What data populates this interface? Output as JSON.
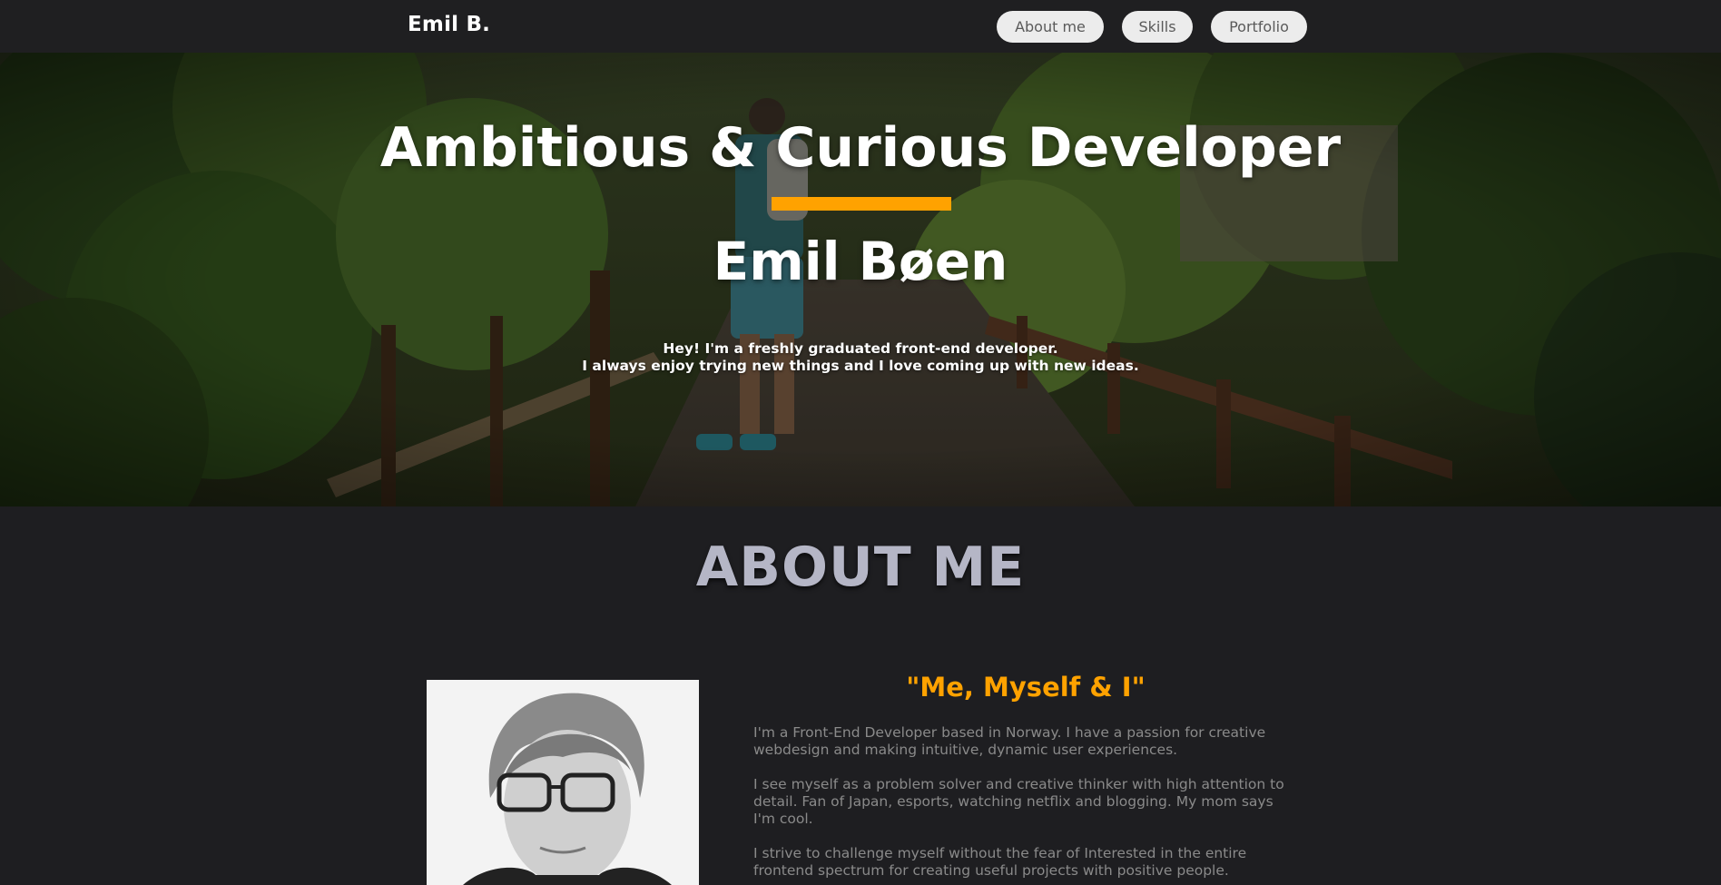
{
  "nav": {
    "brand": "Emil B.",
    "items": [
      {
        "label": "About me"
      },
      {
        "label": "Skills"
      },
      {
        "label": "Portfolio"
      }
    ]
  },
  "hero": {
    "title": "Ambitious & Curious Developer",
    "name": "Emil Bøen",
    "intro_line1": "Hey! I'm a freshly graduated front-end developer.",
    "intro_line2": "I always enjoy trying new things and I love coming up with new ideas."
  },
  "about": {
    "heading": "ABOUT ME",
    "subtitle": "\"Me, Myself & I\"",
    "paragraphs": [
      "I'm a Front-End Developer based in Norway. I have a passion for creative webdesign and making intuitive, dynamic user experiences.",
      "I see myself as a problem solver and creative thinker with high attention to detail. Fan of Japan, esports, watching netflix and blogging. My mom says I'm cool.",
      "I strive to challenge myself without the fear of Interested in the entire frontend spectrum for creating useful projects with positive people."
    ]
  },
  "colors": {
    "accent": "#ffa200",
    "background": "#1e1e21",
    "heading_gray": "#b5b6c6",
    "text_gray": "#8a8a8a"
  }
}
